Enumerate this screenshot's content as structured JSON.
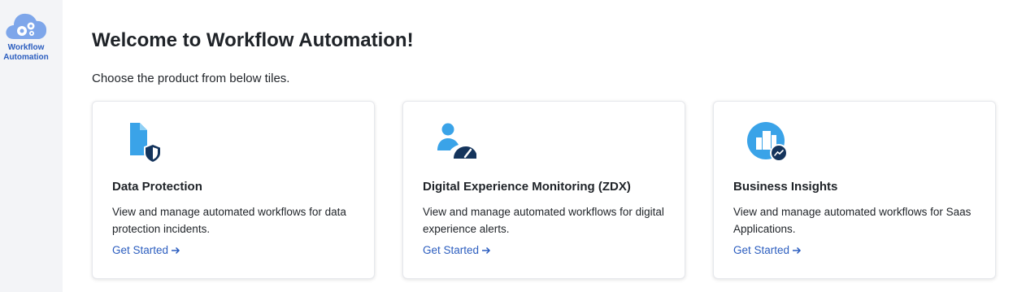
{
  "sidebar": {
    "items": [
      {
        "label": "Workflow Automation",
        "icon": "cloud-gears-icon"
      }
    ]
  },
  "main": {
    "title": "Welcome to Workflow Automation!",
    "subtitle": "Choose the product from below tiles."
  },
  "tiles": [
    {
      "icon": "document-shield-icon",
      "title": "Data Protection",
      "description": "View and manage automated workflows for data protection incidents.",
      "link": "Get Started"
    },
    {
      "icon": "user-gauge-icon",
      "title": "Digital Experience Monitoring (ZDX)",
      "description": "View and manage automated workflows for digital experience alerts.",
      "link": "Get Started"
    },
    {
      "icon": "buildings-trend-icon",
      "title": "Business Insights",
      "description": "View and manage automated workflows for Saas Applications.",
      "link": "Get Started"
    }
  ],
  "colors": {
    "accent": "#2b5dbf",
    "icon_blue": "#3aa3e8",
    "icon_dark": "#14345c"
  }
}
